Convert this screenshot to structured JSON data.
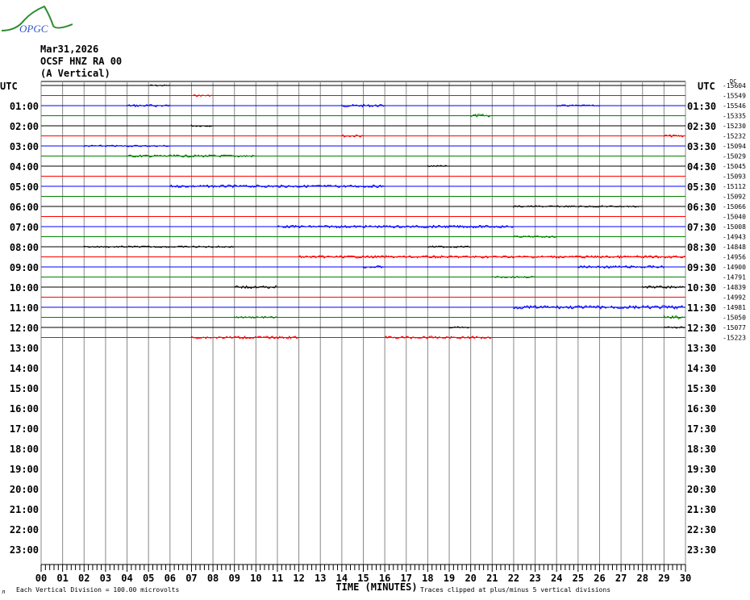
{
  "logo": {
    "text": "OPGC"
  },
  "header": {
    "date": "Mar31,2026",
    "station": "OCSF HNZ RA 00",
    "component": "(A Vertical)"
  },
  "footer": {
    "scale_note": "Each Vertical Division =  100.00 microvolts",
    "clip_note": "Traces clipped at plus/minus 5 vertical divisions",
    "corner_mark": "л"
  },
  "chart_data": {
    "type": "line",
    "title": "Mar31,2026 OCSF HNZ RA 00 (A Vertical)",
    "xlabel": "TIME (MINUTES)",
    "xlim": [
      0,
      30
    ],
    "x_ticks": [
      "00",
      "01",
      "02",
      "03",
      "04",
      "05",
      "06",
      "07",
      "08",
      "09",
      "10",
      "11",
      "12",
      "13",
      "14",
      "15",
      "16",
      "17",
      "18",
      "19",
      "20",
      "21",
      "22",
      "23",
      "24",
      "25",
      "26",
      "27",
      "28",
      "29",
      "30"
    ],
    "left_axis_title": "UTC",
    "right_axis_title": "UTC",
    "dc_label": "DC",
    "left_labels": [
      "01:00",
      "02:00",
      "03:00",
      "04:00",
      "05:00",
      "06:00",
      "07:00",
      "08:00",
      "09:00",
      "10:00",
      "11:00",
      "12:00",
      "13:00",
      "14:00",
      "15:00",
      "16:00",
      "17:00",
      "18:00",
      "19:00",
      "20:00",
      "21:00",
      "22:00",
      "23:00"
    ],
    "right_labels": [
      "01:30",
      "02:30",
      "03:30",
      "04:30",
      "05:30",
      "06:30",
      "07:30",
      "08:30",
      "09:30",
      "10:30",
      "11:30",
      "12:30",
      "13:30",
      "14:30",
      "15:30",
      "16:30",
      "17:30",
      "18:30",
      "19:30",
      "20:30",
      "21:30",
      "22:30",
      "23:30"
    ],
    "trace_colors": [
      "#000000",
      "#ff0000",
      "#0000ff",
      "#008000"
    ],
    "dc_offsets": [
      "-15604",
      "-15549",
      "-15546",
      "-15335",
      "-15230",
      "-15232",
      "-15094",
      "-15029",
      "-15045",
      "-15093",
      "-15112",
      "-15092",
      "-15066",
      "-15040",
      "-15008",
      "-14943",
      "-14848",
      "-14956",
      "-14900",
      "-14791",
      "-14839",
      "-14992",
      "-14981",
      "-15050",
      "-15077",
      "-15223"
    ],
    "activity": [
      [
        0,
        5,
        6,
        1
      ],
      [
        1,
        7,
        8,
        1
      ],
      [
        2,
        4,
        6,
        1.5
      ],
      [
        2,
        14,
        16,
        1.5
      ],
      [
        2,
        24,
        26,
        1
      ],
      [
        3,
        20,
        21,
        2
      ],
      [
        4,
        7,
        8,
        1
      ],
      [
        5,
        14,
        15,
        1.5
      ],
      [
        5,
        29,
        30,
        1.5
      ],
      [
        6,
        2,
        6,
        1
      ],
      [
        7,
        4,
        10,
        1.5
      ],
      [
        8,
        18,
        19,
        1
      ],
      [
        10,
        6,
        16,
        1.5
      ],
      [
        12,
        22,
        28,
        1
      ],
      [
        14,
        11,
        22,
        1.5
      ],
      [
        15,
        22,
        24,
        1
      ],
      [
        16,
        2,
        9,
        1
      ],
      [
        16,
        18,
        20,
        1
      ],
      [
        17,
        12,
        30,
        1.5
      ],
      [
        18,
        15,
        16,
        1.5
      ],
      [
        18,
        25,
        29,
        1.5
      ],
      [
        19,
        21,
        23,
        1
      ],
      [
        20,
        9,
        11,
        1.5
      ],
      [
        20,
        28,
        30,
        1.5
      ],
      [
        22,
        22,
        30,
        2
      ],
      [
        23,
        9,
        11,
        1
      ],
      [
        23,
        29,
        30,
        2
      ],
      [
        24,
        19,
        20,
        1
      ],
      [
        24,
        29,
        30,
        1
      ],
      [
        25,
        7,
        12,
        1.5
      ],
      [
        25,
        16,
        21,
        1.5
      ]
    ]
  }
}
